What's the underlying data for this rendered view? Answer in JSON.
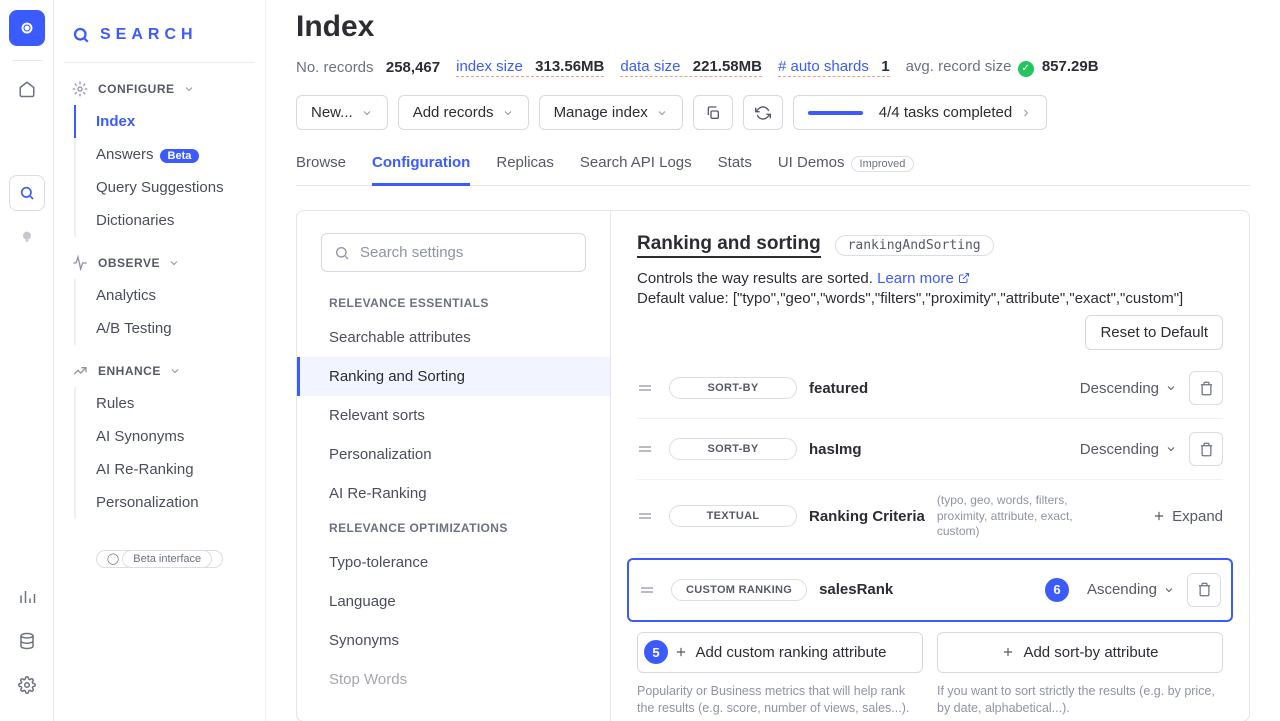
{
  "brand": "SEARCH",
  "rail": {
    "beta_label": "Beta interface"
  },
  "sidebar": {
    "configure": {
      "label": "CONFIGURE",
      "items": [
        "Index",
        "Answers",
        "Query Suggestions",
        "Dictionaries"
      ],
      "beta": "Beta"
    },
    "observe": {
      "label": "OBSERVE",
      "items": [
        "Analytics",
        "A/B Testing"
      ]
    },
    "enhance": {
      "label": "ENHANCE",
      "items": [
        "Rules",
        "AI Synonyms",
        "AI Re-Ranking",
        "Personalization"
      ]
    }
  },
  "header": {
    "title": "Index",
    "stats": {
      "records_label": "No. records",
      "records_val": "258,467",
      "idx_size_label": "index size",
      "idx_size_val": "313.56MB",
      "data_size_label": "data size",
      "data_size_val": "221.58MB",
      "shards_label": "# auto shards",
      "shards_val": "1",
      "avg_label": "avg. record size",
      "avg_val": "857.29B"
    },
    "toolbar": {
      "new": "New...",
      "add": "Add records",
      "manage": "Manage index",
      "tasks": "4/4 tasks completed"
    },
    "tabs": [
      "Browse",
      "Configuration",
      "Replicas",
      "Search API Logs",
      "Stats",
      "UI Demos"
    ],
    "improved": "Improved"
  },
  "settings": {
    "search_ph": "Search settings",
    "cat1": "RELEVANCE ESSENTIALS",
    "items1": [
      "Searchable attributes",
      "Ranking and Sorting",
      "Relevant sorts",
      "Personalization",
      "AI Re-Ranking"
    ],
    "cat2": "RELEVANCE OPTIMIZATIONS",
    "items2": [
      "Typo-tolerance",
      "Language",
      "Synonyms",
      "Stop Words"
    ]
  },
  "ranking": {
    "title": "Ranking and sorting",
    "code": "rankingAndSorting",
    "desc": "Controls the way results are sorted. ",
    "learn": "Learn more",
    "default": "Default value: [\"typo\",\"geo\",\"words\",\"filters\",\"proximity\",\"attribute\",\"exact\",\"custom\"]",
    "reset": "Reset to Default",
    "rows": [
      {
        "type": "SORT-BY",
        "name": "featured",
        "dir": "Descending"
      },
      {
        "type": "SORT-BY",
        "name": "hasImg",
        "dir": "Descending"
      },
      {
        "type": "TEXTUAL",
        "name": "Ranking Criteria",
        "detail": "(typo, geo, words, filters, proximity, attribute, exact, custom)",
        "expand": "Expand"
      },
      {
        "type": "CUSTOM RANKING",
        "name": "salesRank",
        "dir": "Ascending"
      }
    ],
    "add_custom": "Add custom ranking attribute",
    "add_sort": "Add sort-by attribute",
    "note1": "Popularity or Business metrics that will help rank the results (e.g. score, number of views, sales...).",
    "note2": "If you want to sort strictly the results (e.g. by price, by date, alphabetical...).",
    "num5": "5",
    "num6": "6"
  }
}
